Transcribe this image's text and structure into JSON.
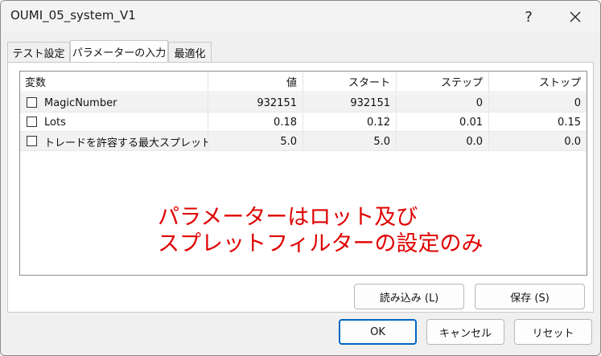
{
  "window": {
    "title": "OUMI_05_system_V1",
    "help_label": "?",
    "close_icon": "close-icon"
  },
  "tabs": [
    {
      "label": "テスト設定",
      "active": false
    },
    {
      "label": "パラメーターの入力",
      "active": true
    },
    {
      "label": "最適化",
      "active": false
    }
  ],
  "table": {
    "headers": [
      "変数",
      "値",
      "スタート",
      "ステップ",
      "ストップ"
    ],
    "rows": [
      {
        "checked": false,
        "name": "MagicNumber",
        "value": "932151",
        "start": "932151",
        "step": "0",
        "stop": "0"
      },
      {
        "checked": false,
        "name": "Lots",
        "value": "0.18",
        "start": "0.12",
        "step": "0.01",
        "stop": "0.15"
      },
      {
        "checked": false,
        "name": "トレードを許容する最大スプレッド...",
        "value": "5.0",
        "start": "5.0",
        "step": "0.0",
        "stop": "0.0"
      }
    ]
  },
  "annotation": {
    "text": "パラメーターはロット及び\nスプレットフィルターの設定のみ",
    "color": "#e00000"
  },
  "buttons": {
    "load": "読み込み (L)",
    "save": "保存 (S)",
    "ok": "OK",
    "cancel": "キャンセル",
    "reset": "リセット"
  }
}
